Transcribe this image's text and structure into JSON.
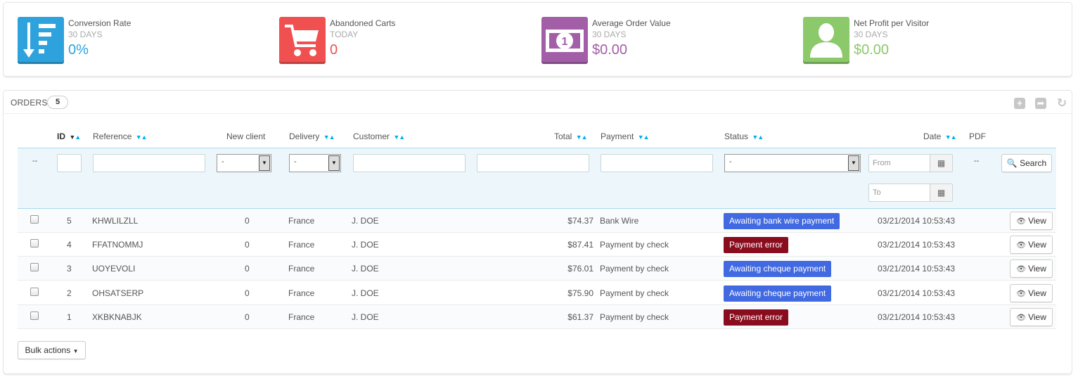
{
  "kpis": [
    {
      "title": "Conversion Rate",
      "period": "30 DAYS",
      "value": "0%",
      "icon": "sort-list-icon",
      "color": "#2ea2dc"
    },
    {
      "title": "Abandoned Carts",
      "period": "TODAY",
      "value": "0",
      "icon": "cart-icon",
      "color": "#f05050"
    },
    {
      "title": "Average Order Value",
      "period": "30 DAYS",
      "value": "$0.00",
      "icon": "money-icon",
      "color": "#a25ea7"
    },
    {
      "title": "Net Profit per Visitor",
      "period": "30 DAYS",
      "value": "$0.00",
      "icon": "user-icon",
      "color": "#8bc96a"
    }
  ],
  "orders": {
    "title": "ORDERS",
    "count": "5",
    "columns": {
      "id": "ID",
      "reference": "Reference",
      "new_client": "New client",
      "delivery": "Delivery",
      "customer": "Customer",
      "total": "Total",
      "payment": "Payment",
      "status": "Status",
      "date": "Date",
      "pdf": "PDF"
    },
    "filters": {
      "select_default": "-",
      "date_from_placeholder": "From",
      "date_to_placeholder": "To",
      "empty_dash": "--",
      "search_label": "Search"
    },
    "rows": [
      {
        "id": "5",
        "reference": "KHWLILZLL",
        "new_client": "0",
        "delivery": "France",
        "customer": "J. DOE",
        "total": "$74.37",
        "payment": "Bank Wire",
        "status": "Awaiting bank wire payment",
        "status_color": "#4169e1",
        "date": "03/21/2014 10:53:43",
        "action": "View"
      },
      {
        "id": "4",
        "reference": "FFATNOMMJ",
        "new_client": "0",
        "delivery": "France",
        "customer": "J. DOE",
        "total": "$87.41",
        "payment": "Payment by check",
        "status": "Payment error",
        "status_color": "#8a0d1f",
        "date": "03/21/2014 10:53:43",
        "action": "View"
      },
      {
        "id": "3",
        "reference": "UOYEVOLI",
        "new_client": "0",
        "delivery": "France",
        "customer": "J. DOE",
        "total": "$76.01",
        "payment": "Payment by check",
        "status": "Awaiting cheque payment",
        "status_color": "#4169e1",
        "date": "03/21/2014 10:53:43",
        "action": "View"
      },
      {
        "id": "2",
        "reference": "OHSATSERP",
        "new_client": "0",
        "delivery": "France",
        "customer": "J. DOE",
        "total": "$75.90",
        "payment": "Payment by check",
        "status": "Awaiting cheque payment",
        "status_color": "#4169e1",
        "date": "03/21/2014 10:53:43",
        "action": "View"
      },
      {
        "id": "1",
        "reference": "XKBKNABJK",
        "new_client": "0",
        "delivery": "France",
        "customer": "J. DOE",
        "total": "$61.37",
        "payment": "Payment by check",
        "status": "Payment error",
        "status_color": "#8a0d1f",
        "date": "03/21/2014 10:53:43",
        "action": "View"
      }
    ],
    "bulk_actions_label": "Bulk actions"
  }
}
